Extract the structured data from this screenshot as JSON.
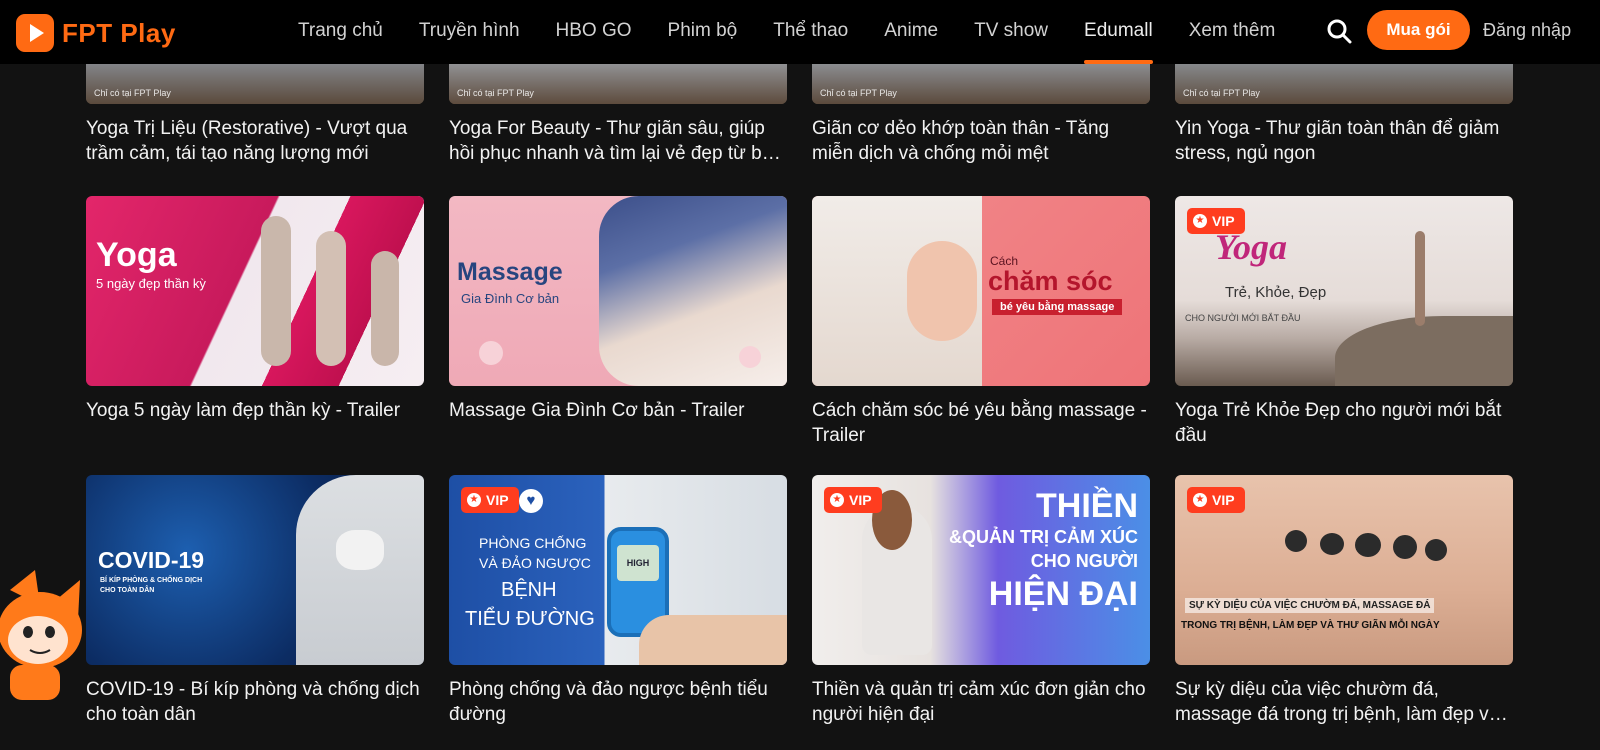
{
  "app": {
    "logo_text": "FPT Play"
  },
  "nav": {
    "items": [
      {
        "label": "Trang chủ"
      },
      {
        "label": "Truyền hình"
      },
      {
        "label": "HBO GO"
      },
      {
        "label": "Phim bộ"
      },
      {
        "label": "Thể thao"
      },
      {
        "label": "Anime"
      },
      {
        "label": "TV show"
      },
      {
        "label": "Edumall",
        "active": true
      },
      {
        "label": "Xem thêm"
      }
    ],
    "buy_label": "Mua gói",
    "login_label": "Đăng nhập",
    "accent": "#ff6a13"
  },
  "badges": {
    "vip": "VIP",
    "watermark": "Chỉ có tại FPT Play"
  },
  "rows": [
    {
      "cards": [
        {
          "title": "Yoga Trị Liệu (Restorative) - Vượt qua trầm cảm, tái tạo năng lượng mới",
          "vip": false
        },
        {
          "title": "Yoga For Beauty - Thư giãn sâu, giúp hồi phục nhanh và tìm lại vẻ đẹp từ bên trong",
          "vip": false
        },
        {
          "title": "Giãn cơ dẻo khớp toàn thân - Tăng miễn dịch và chống mỏi mệt",
          "vip": false
        },
        {
          "title": "Yin Yoga - Thư giãn toàn thân để giảm stress, ngủ ngon",
          "vip": false
        }
      ]
    },
    {
      "cards": [
        {
          "title": "Yoga 5 ngày làm đẹp thần kỳ - Trailer",
          "vip": false,
          "art": {
            "line1": "Yoga",
            "line2": "5 ngày đẹp thần kỳ"
          }
        },
        {
          "title": "Massage Gia Đình Cơ bản - Trailer",
          "vip": false,
          "art": {
            "line1": "Massage",
            "line2": "Gia Đình Cơ bản"
          }
        },
        {
          "title": "Cách chăm sóc bé yêu bằng massage - Trailer",
          "vip": false,
          "art": {
            "line0": "Cách",
            "line1": "chăm sóc",
            "line2": "bé yêu bằng massage"
          }
        },
        {
          "title": "Yoga Trẻ Khỏe Đẹp cho người mới bắt đầu",
          "vip": true,
          "art": {
            "line1": "Yoga",
            "line2": "Trẻ, Khỏe, Đẹp",
            "line3": "CHO NGƯỜI MỚI BẮT ĐẦU"
          }
        }
      ]
    },
    {
      "cards": [
        {
          "title": "COVID-19 - Bí kíp phòng và chống dịch cho toàn dân",
          "vip": false,
          "art": {
            "line1": "COVID-19",
            "line2": "BÍ KÍP PHÒNG & CHỐNG DỊCH",
            "line3": "CHO TOÀN DÂN"
          }
        },
        {
          "title": "Phòng chống và đảo ngược bệnh tiểu đường",
          "vip": true,
          "art": {
            "line1": "PHÒNG CHỐNG",
            "line2": "VÀ ĐẢO NGƯỢC",
            "line3": "BỆNH",
            "line4": "TIỂU ĐƯỜNG",
            "meter": "HIGH"
          }
        },
        {
          "title": "Thiền và quản trị cảm xúc đơn giản cho người hiện đại",
          "vip": true,
          "art": {
            "line1": "THIỀN",
            "line2": "&QUẢN TRỊ CẢM XÚC",
            "line3": "CHO NGƯỜI",
            "line4": "HIỆN ĐẠI"
          }
        },
        {
          "title": "Sự kỳ diệu của việc chườm đá, massage đá trong trị bệnh, làm đẹp và thư giãn mỗi ngày",
          "vip": true,
          "art": {
            "line1": "SỰ KỲ DIỆU CỦA VIỆC CHƯỜM ĐÁ, MASSAGE ĐÁ",
            "line2": "TRONG TRỊ BỆNH, LÀM ĐẸP VÀ THƯ GIÃN MỖI NGÀY"
          }
        }
      ]
    }
  ]
}
